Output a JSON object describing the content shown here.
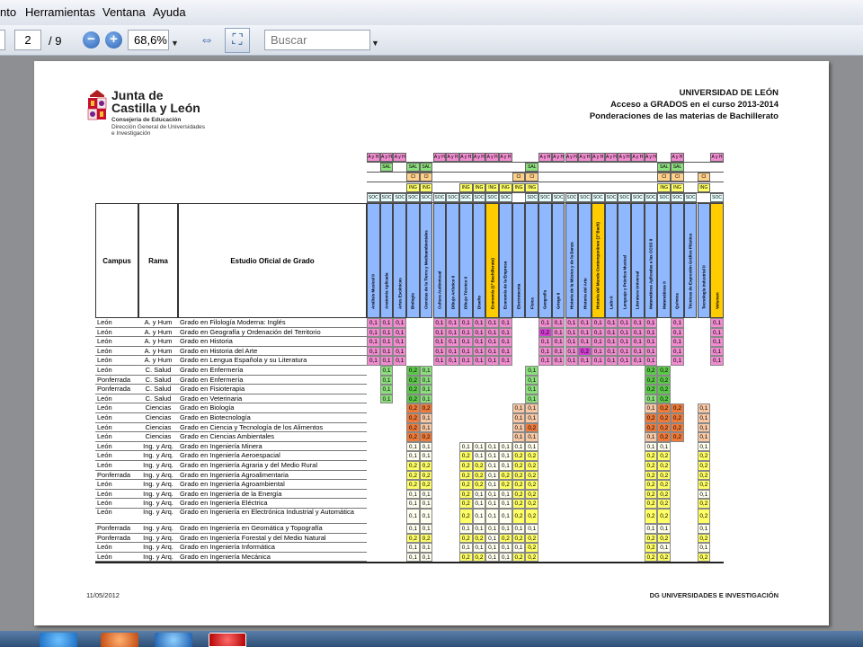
{
  "menu": [
    "nto",
    "Herramientas",
    "Ventana",
    "Ayuda"
  ],
  "toolbar": {
    "page_current": "2",
    "page_total": "/ 9",
    "zoom": "68,6%",
    "search_placeholder": "Buscar"
  },
  "doc": {
    "org_line1": "Junta de",
    "org_line2": "Castilla y León",
    "dept1": "Consejería de Educación",
    "dept2": "Dirección General de Universidades",
    "dept3": "e Investigación",
    "title1": "UNIVERSIDAD DE LEÓN",
    "title2": "Acceso a GRADOS en el curso 2013-2014",
    "title3": "Ponderaciones de las materias de Bachillerato",
    "col_campus": "Campus",
    "col_rama": "Rama",
    "col_estudio": "Estudio Oficial de Grado",
    "footer_date": "11/05/2012",
    "footer_right": "DG UNIVERSIDADES  E INVESTIGACIÓN"
  },
  "subjects": [
    "Análisis Musical II",
    "Anatomía Aplicada",
    "Artes Escénicas",
    "Biología",
    "Ciencias de la Tierra y Medioambientales",
    "Cultura Audiovisual",
    "Dibujo Artístico II",
    "Dibujo Técnico II",
    "Diseño",
    "Economía (1º Bachillerato)",
    "Economía de la Empresa",
    "Electrotecnia",
    "Física",
    "Geografía",
    "Griego II",
    "Historia de la Música y de la Danza",
    "Historia del Arte",
    "Historia del Mundo Contemporáneo (1º Bach)",
    "Latín II",
    "Lenguaje y Práctica Musical",
    "Literatura Universal",
    "Matemáticas Aplicadas a las CCSS II",
    "Matemáticas II",
    "Química",
    "Técnicas de Expresión Gráfico Plástica",
    "Tecnología Industrial II",
    "Volumen"
  ],
  "rows": [
    {
      "campus": "León",
      "rama": "A. y Hum",
      "grado": "Grado en Filología Moderna: Inglés"
    },
    {
      "campus": "León",
      "rama": "A. y Hum",
      "grado": "Grado en Geografía y Ordenación del Territorio"
    },
    {
      "campus": "León",
      "rama": "A. y Hum",
      "grado": "Grado en Historia"
    },
    {
      "campus": "León",
      "rama": "A. y Hum",
      "grado": "Grado en Historia del Arte"
    },
    {
      "campus": "León",
      "rama": "A. y Hum",
      "grado": "Grado en Lengua Española y su Literatura"
    },
    {
      "campus": "León",
      "rama": "C. Salud",
      "grado": "Grado en Enfermería"
    },
    {
      "campus": "Ponferrada",
      "rama": "C. Salud",
      "grado": "Grado en Enfermería"
    },
    {
      "campus": "Ponferrada",
      "rama": "C. Salud",
      "grado": "Grado en Fisioterapia"
    },
    {
      "campus": "León",
      "rama": "C. Salud",
      "grado": "Grado en Veterinaria"
    },
    {
      "campus": "León",
      "rama": "Ciencias",
      "grado": "Grado en Biología"
    },
    {
      "campus": "León",
      "rama": "Ciencias",
      "grado": "Grado en Biotecnología"
    },
    {
      "campus": "León",
      "rama": "Ciencias",
      "grado": "Grado en Ciencia y Tecnología de los Alimentos"
    },
    {
      "campus": "León",
      "rama": "Ciencias",
      "grado": "Grado en Ciencias Ambientales"
    },
    {
      "campus": "León",
      "rama": "Ing. y Arq.",
      "grado": "Grado en  Ingeniería Minera"
    },
    {
      "campus": "León",
      "rama": "Ing. y Arq.",
      "grado": "Grado en Ingeniería Aeroespacial"
    },
    {
      "campus": "León",
      "rama": "Ing. y Arq.",
      "grado": "Grado en Ingeniería Agraria y del Medio Rural"
    },
    {
      "campus": "Ponferrada",
      "rama": "Ing. y Arq.",
      "grado": "Grado en Ingeniería Agroalimentaria"
    },
    {
      "campus": "León",
      "rama": "Ing. y Arq.",
      "grado": "Grado en Ingeniería Agroambiental"
    },
    {
      "campus": "León",
      "rama": "Ing. y Arq.",
      "grado": "Grado en Ingeniería de la Energía"
    },
    {
      "campus": "León",
      "rama": "Ing. y Arq.",
      "grado": "Grado en Ingeniería Eléctrica"
    },
    {
      "campus": "León",
      "rama": "Ing. y Arq.",
      "grado": "Grado en Ingeniería en Electrónica Industrial y Automática",
      "tall": true
    },
    {
      "campus": "Ponferrada",
      "rama": "Ing. y Arq.",
      "grado": "Grado en Ingeniería en Geomática y Topografía"
    },
    {
      "campus": "Ponferrada",
      "rama": "Ing. y Arq.",
      "grado": "Grado en Ingeniería Forestal y del Medio Natural"
    },
    {
      "campus": "León",
      "rama": "Ing. y Arq.",
      "grado": "Grado en Ingeniería Informática"
    },
    {
      "campus": "León",
      "rama": "Ing. y Arq.",
      "grado": "Grado en Ingeniería Mecánica"
    }
  ],
  "values": [
    [
      "0,1",
      "0,1",
      "0,1",
      "",
      "",
      "0,1",
      "0,1",
      "0,1",
      "0,1",
      "0,1",
      "0,1",
      "",
      "",
      "0,1",
      "0,1",
      "0,1",
      "0,1",
      "0,1",
      "0,1",
      "0,1",
      "0,1",
      "0,1",
      "",
      "0,1",
      "",
      "",
      "0,1"
    ],
    [
      "0,1",
      "0,1",
      "0,1",
      "",
      "",
      "0,1",
      "0,1",
      "0,1",
      "0,1",
      "0,1",
      "0,1",
      "",
      "",
      "0,2",
      "0,1",
      "0,1",
      "0,1",
      "0,1",
      "0,1",
      "0,1",
      "0,1",
      "0,1",
      "",
      "0,1",
      "",
      "",
      "0,1"
    ],
    [
      "0,1",
      "0,1",
      "0,1",
      "",
      "",
      "0,1",
      "0,1",
      "0,1",
      "0,1",
      "0,1",
      "0,1",
      "",
      "",
      "0,1",
      "0,1",
      "0,1",
      "0,1",
      "0,1",
      "0,1",
      "0,1",
      "0,1",
      "0,1",
      "",
      "0,1",
      "",
      "",
      "0,1"
    ],
    [
      "0,1",
      "0,1",
      "0,1",
      "",
      "",
      "0,1",
      "0,1",
      "0,1",
      "0,1",
      "0,1",
      "0,1",
      "",
      "",
      "0,1",
      "0,1",
      "0,1",
      "0,2",
      "0,1",
      "0,1",
      "0,1",
      "0,1",
      "0,1",
      "",
      "0,1",
      "",
      "",
      "0,1"
    ],
    [
      "0,1",
      "0,1",
      "0,1",
      "",
      "",
      "0,1",
      "0,1",
      "0,1",
      "0,1",
      "0,1",
      "0,1",
      "",
      "",
      "0,1",
      "0,1",
      "0,1",
      "0,1",
      "0,1",
      "0,1",
      "0,1",
      "0,1",
      "0,1",
      "",
      "0,1",
      "",
      "",
      "0,1"
    ],
    [
      "",
      "0,1",
      "",
      "0,2",
      "0,1",
      "",
      "",
      "",
      "",
      "",
      "",
      "",
      "0,1",
      "",
      "",
      "",
      "",
      "",
      "",
      "",
      "",
      "0,2",
      "0,2",
      "",
      "",
      "",
      ""
    ],
    [
      "",
      "0,1",
      "",
      "0,2",
      "0,1",
      "",
      "",
      "",
      "",
      "",
      "",
      "",
      "0,1",
      "",
      "",
      "",
      "",
      "",
      "",
      "",
      "",
      "0,2",
      "0,2",
      "",
      "",
      "",
      ""
    ],
    [
      "",
      "0,1",
      "",
      "0,2",
      "0,1",
      "",
      "",
      "",
      "",
      "",
      "",
      "",
      "0,1",
      "",
      "",
      "",
      "",
      "",
      "",
      "",
      "",
      "0,2",
      "0,2",
      "",
      "",
      "",
      ""
    ],
    [
      "",
      "0,1",
      "",
      "0,2",
      "0,1",
      "",
      "",
      "",
      "",
      "",
      "",
      "",
      "0,1",
      "",
      "",
      "",
      "",
      "",
      "",
      "",
      "",
      "0,1",
      "0,2",
      "",
      "",
      "",
      ""
    ],
    [
      "",
      "",
      "",
      "0,2",
      "0,2",
      "",
      "",
      "",
      "",
      "",
      "",
      "0,1",
      "0,1",
      "",
      "",
      "",
      "",
      "",
      "",
      "",
      "",
      "0,1",
      "0,2",
      "0,2",
      "",
      "0,1",
      ""
    ],
    [
      "",
      "",
      "",
      "0,2",
      "0,1",
      "",
      "",
      "",
      "",
      "",
      "",
      "0,1",
      "0,1",
      "",
      "",
      "",
      "",
      "",
      "",
      "",
      "",
      "0,2",
      "0,2",
      "0,2",
      "",
      "0,1",
      ""
    ],
    [
      "",
      "",
      "",
      "0,2",
      "0,1",
      "",
      "",
      "",
      "",
      "",
      "",
      "0,1",
      "0,2",
      "",
      "",
      "",
      "",
      "",
      "",
      "",
      "",
      "0,2",
      "0,2",
      "0,2",
      "",
      "0,1",
      ""
    ],
    [
      "",
      "",
      "",
      "0,2",
      "0,2",
      "",
      "",
      "",
      "",
      "",
      "",
      "0,1",
      "0,1",
      "",
      "",
      "",
      "",
      "",
      "",
      "",
      "",
      "0,1",
      "0,2",
      "0,2",
      "",
      "0,1",
      ""
    ],
    [
      "",
      "",
      "",
      "0,1",
      "0,1",
      "",
      "",
      "0,1",
      "0,1",
      "0,1",
      "0,1",
      "0,1",
      "0,1",
      "",
      "",
      "",
      "",
      "",
      "",
      "",
      "",
      "0,1",
      "0,1",
      "",
      "",
      "0,1",
      ""
    ],
    [
      "",
      "",
      "",
      "0,1",
      "0,1",
      "",
      "",
      "0,2",
      "0,1",
      "0,1",
      "0,1",
      "0,2",
      "0,2",
      "",
      "",
      "",
      "",
      "",
      "",
      "",
      "",
      "0,2",
      "0,2",
      "",
      "",
      "0,2",
      ""
    ],
    [
      "",
      "",
      "",
      "0,2",
      "0,2",
      "",
      "",
      "0,2",
      "0,2",
      "0,1",
      "0,1",
      "0,2",
      "0,2",
      "",
      "",
      "",
      "",
      "",
      "",
      "",
      "",
      "0,2",
      "0,2",
      "",
      "",
      "0,2",
      ""
    ],
    [
      "",
      "",
      "",
      "0,2",
      "0,2",
      "",
      "",
      "0,2",
      "0,2",
      "0,1",
      "0,2",
      "0,2",
      "0,2",
      "",
      "",
      "",
      "",
      "",
      "",
      "",
      "",
      "0,2",
      "0,2",
      "",
      "",
      "0,2",
      ""
    ],
    [
      "",
      "",
      "",
      "0,2",
      "0,2",
      "",
      "",
      "0,2",
      "0,2",
      "0,1",
      "0,2",
      "0,2",
      "0,2",
      "",
      "",
      "",
      "",
      "",
      "",
      "",
      "",
      "0,2",
      "0,2",
      "",
      "",
      "0,2",
      ""
    ],
    [
      "",
      "",
      "",
      "0,1",
      "0,1",
      "",
      "",
      "0,2",
      "0,1",
      "0,1",
      "0,1",
      "0,2",
      "0,2",
      "",
      "",
      "",
      "",
      "",
      "",
      "",
      "",
      "0,2",
      "0,2",
      "",
      "",
      "0,1",
      ""
    ],
    [
      "",
      "",
      "",
      "0,1",
      "0,1",
      "",
      "",
      "0,2",
      "0,1",
      "0,1",
      "0,1",
      "0,2",
      "0,2",
      "",
      "",
      "",
      "",
      "",
      "",
      "",
      "",
      "0,2",
      "0,2",
      "",
      "",
      "0,2",
      ""
    ],
    [
      "",
      "",
      "",
      "0,1",
      "0,1",
      "",
      "",
      "0,2",
      "0,1",
      "0,1",
      "0,1",
      "0,2",
      "0,2",
      "",
      "",
      "",
      "",
      "",
      "",
      "",
      "",
      "0,2",
      "0,2",
      "",
      "",
      "0,2",
      ""
    ],
    [
      "",
      "",
      "",
      "0,1",
      "0,1",
      "",
      "",
      "0,1",
      "0,1",
      "0,1",
      "0,1",
      "0,1",
      "0,1",
      "",
      "",
      "",
      "",
      "",
      "",
      "",
      "",
      "0,1",
      "0,1",
      "",
      "",
      "0,1",
      ""
    ],
    [
      "",
      "",
      "",
      "0,2",
      "0,2",
      "",
      "",
      "0,2",
      "0,2",
      "0,1",
      "0,2",
      "0,2",
      "0,2",
      "",
      "",
      "",
      "",
      "",
      "",
      "",
      "",
      "0,2",
      "0,2",
      "",
      "",
      "0,2",
      ""
    ],
    [
      "",
      "",
      "",
      "0,1",
      "0,1",
      "",
      "",
      "0,1",
      "0,1",
      "0,1",
      "0,1",
      "0,1",
      "0,2",
      "",
      "",
      "",
      "",
      "",
      "",
      "",
      "",
      "0,2",
      "0,1",
      "",
      "",
      "0,1",
      ""
    ],
    [
      "",
      "",
      "",
      "0,1",
      "0,1",
      "",
      "",
      "0,2",
      "0,2",
      "0,1",
      "0,1",
      "0,2",
      "0,2",
      "",
      "",
      "",
      "",
      "",
      "",
      "",
      "",
      "0,2",
      "0,2",
      "",
      "",
      "0,2",
      ""
    ]
  ],
  "code_rows": [
    {
      "label": "A y H",
      "cols": [
        0,
        1,
        2,
        5,
        6,
        7,
        8,
        9,
        10,
        13,
        14,
        15,
        16,
        17,
        18,
        19,
        20,
        21,
        23,
        26
      ]
    },
    {
      "label": "SAL",
      "cols": [
        1,
        3,
        4,
        12,
        22,
        23
      ]
    },
    {
      "label": "CI",
      "cols": [
        3,
        4,
        11,
        12,
        22,
        23,
        25
      ]
    },
    {
      "label": "ING",
      "cols": [
        3,
        4,
        7,
        8,
        9,
        10,
        11,
        12,
        22,
        23,
        25
      ]
    },
    {
      "label": "SOC",
      "cols": [
        0,
        1,
        2,
        3,
        4,
        5,
        6,
        7,
        8,
        9,
        10,
        12,
        13,
        14,
        15,
        16,
        17,
        18,
        19,
        20,
        21,
        22,
        23,
        24,
        26
      ]
    }
  ],
  "colors": {
    "pink": "#f08ccf",
    "magenta": "#d63fd6",
    "green": "#8ddf7e",
    "orange": "#ef7a3a",
    "yellow": "#ffff66",
    "blue_col": "#8fb8ff",
    "gold_col": "#ffcc00"
  }
}
